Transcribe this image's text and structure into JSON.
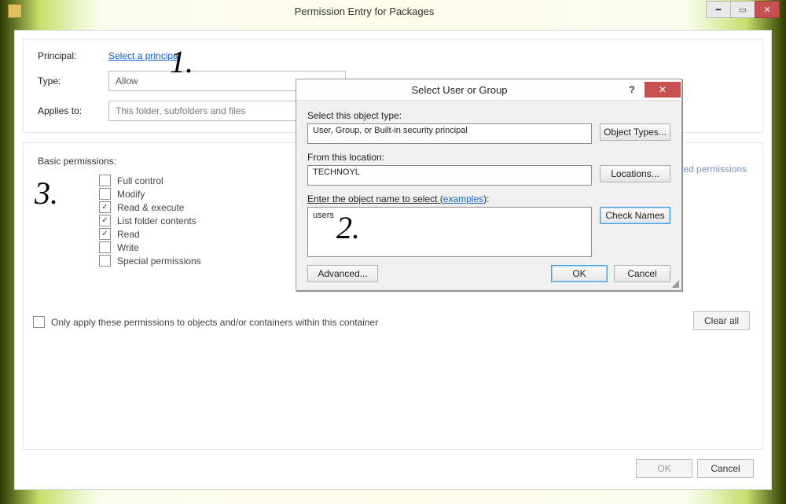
{
  "window": {
    "title": "Permission Entry for Packages"
  },
  "top": {
    "principal_label": "Principal:",
    "principal_link": "Select a principal",
    "type_label": "Type:",
    "type_value": "Allow",
    "applies_label": "Applies to:",
    "applies_value": "This folder, subfolders and files"
  },
  "permissions": {
    "heading": "Basic permissions:",
    "items": [
      {
        "label": "Full control",
        "checked": false
      },
      {
        "label": "Modify",
        "checked": false
      },
      {
        "label": "Read & execute",
        "checked": true
      },
      {
        "label": "List folder contents",
        "checked": true
      },
      {
        "label": "Read",
        "checked": true
      },
      {
        "label": "Write",
        "checked": false
      },
      {
        "label": "Special permissions",
        "checked": false
      }
    ],
    "advanced_link": "anced permissions",
    "only_apply": "Only apply these permissions to objects and/or containers within this container",
    "clear_all": "Clear all"
  },
  "footer": {
    "ok": "OK",
    "cancel": "Cancel"
  },
  "select_dialog": {
    "title": "Select User or Group",
    "obj_type_label": "Select this object type:",
    "obj_type_value": "User, Group, or Built-in security principal",
    "obj_types_btn": "Object Types...",
    "location_label": "From this location:",
    "location_value": "TECHNOYL",
    "locations_btn": "Locations...",
    "enter_label_pre": "Enter the object name to select (",
    "enter_label_link": "examples",
    "enter_label_post": "):",
    "name_value": "users",
    "check_names": "Check Names",
    "advanced": "Advanced...",
    "ok": "OK",
    "cancel": "Cancel"
  },
  "annotations": {
    "one": "1.",
    "two": "2.",
    "three": "3."
  }
}
